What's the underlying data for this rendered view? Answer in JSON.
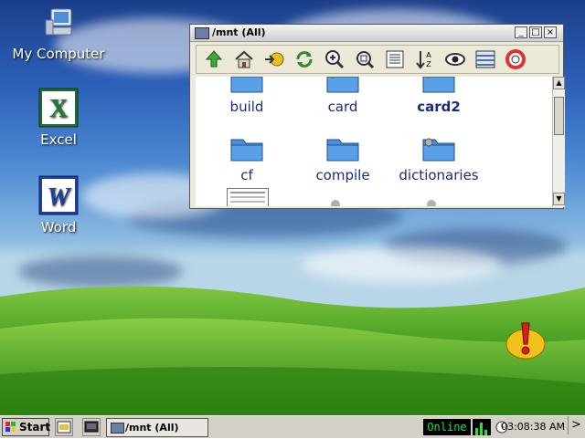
{
  "desktop": {
    "icons": [
      {
        "label": "My Computer",
        "icon": "computer-icon"
      },
      {
        "label": "Excel",
        "icon": "excel-icon"
      },
      {
        "label": "Word",
        "icon": "word-icon"
      }
    ]
  },
  "window": {
    "title": "/mnt (All)",
    "toolbar": [
      "up-icon",
      "home-icon",
      "go-icon",
      "refresh-icon",
      "zoom-in-icon",
      "zoom-fit-icon",
      "details-icon",
      "sort-icon",
      "view-icon",
      "list-icon",
      "help-icon"
    ],
    "folders": [
      {
        "label": "build",
        "bold": false
      },
      {
        "label": "card",
        "bold": false
      },
      {
        "label": "card2",
        "bold": true
      },
      {
        "label": "cf",
        "bold": false
      },
      {
        "label": "compile",
        "bold": false
      },
      {
        "label": "dictionaries",
        "bold": false
      }
    ]
  },
  "taskbar": {
    "start_label": "Start",
    "task_label": "/mnt (All)",
    "status": "Online",
    "clock": "03:08:38 AM",
    "more": ">"
  },
  "colors": {
    "folder": "#4a8fd8",
    "folder_label": "#1c2b7c",
    "status_text": "#27e03a"
  }
}
